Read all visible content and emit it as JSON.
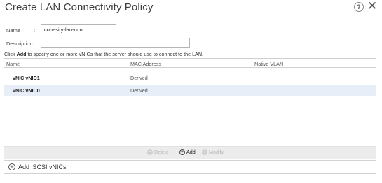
{
  "dialog": {
    "title": "Create LAN Connectivity Policy",
    "help_symbol": "?",
    "close_symbol": "✕"
  },
  "form": {
    "name_label": "Name",
    "colon": ":",
    "name_value": "cohesity-lan-con",
    "description_label": "Description :",
    "description_value": ""
  },
  "hint": {
    "prefix": "Click ",
    "bold": "Add",
    "suffix": " to specify one or more vNICs that the server should use to connect to the LAN."
  },
  "table": {
    "columns": [
      "Name",
      "MAC Address",
      "Native VLAN"
    ],
    "rows": [
      {
        "name": "vNIC vNIC1",
        "mac": "Derived",
        "vlan": "",
        "selected": false
      },
      {
        "name": "vNIC vNIC0",
        "mac": "Derived",
        "vlan": "",
        "selected": true
      }
    ]
  },
  "toolbar": {
    "delete_label": "Delete",
    "add_label": "Add",
    "modify_label": "Modify",
    "delete_symbol": "−",
    "add_symbol": "+",
    "modify_symbol": "i"
  },
  "iscsi": {
    "symbol": "+",
    "label": "Add iSCSI vNICs"
  },
  "colors": {
    "selected_row": "#e7eef7",
    "toolbar_bg": "#ececec"
  }
}
